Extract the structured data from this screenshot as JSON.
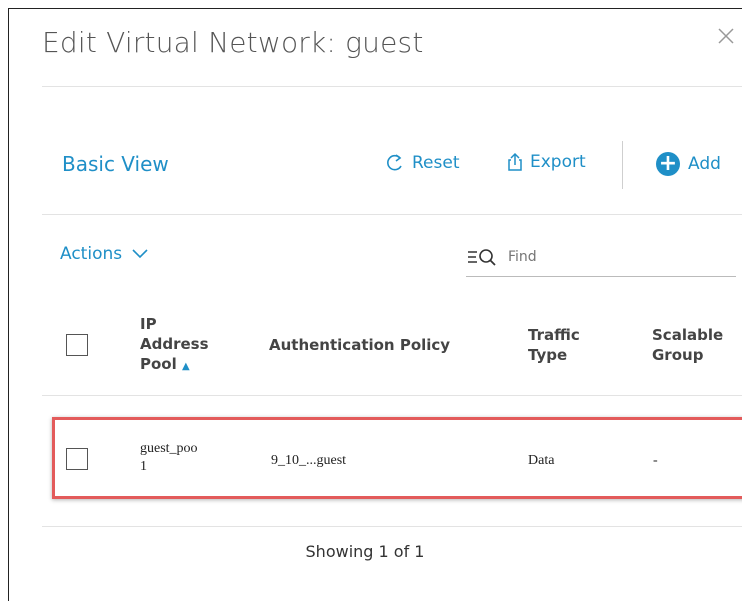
{
  "dialog": {
    "title": "Edit Virtual Network: guest"
  },
  "toolbar": {
    "view_label": "Basic View",
    "reset_label": "Reset",
    "export_label": "Export",
    "add_label": "Add"
  },
  "filterbar": {
    "actions_label": "Actions",
    "search_placeholder": "Find"
  },
  "table": {
    "headers": {
      "ip_pool": [
        "IP",
        "Address",
        "Pool"
      ],
      "auth_policy": "Authentication Policy",
      "traffic_type": [
        "Traffic",
        "Type"
      ],
      "scalable_group": [
        "Scalable",
        "Group"
      ]
    },
    "sort_indicator": "▲",
    "rows": [
      {
        "ip_pool": [
          "guest_poo",
          "1"
        ],
        "auth_policy": "9_10_...guest",
        "traffic_type": "Data",
        "scalable_group": "-"
      }
    ]
  },
  "footer": {
    "status": "Showing 1 of 1"
  },
  "colors": {
    "accent": "#1f8fc7",
    "highlight": "#e35b5b"
  },
  "icons": [
    "close-icon",
    "reset-icon",
    "export-icon",
    "add-icon",
    "chevron-down-icon",
    "filter-search-icon"
  ]
}
